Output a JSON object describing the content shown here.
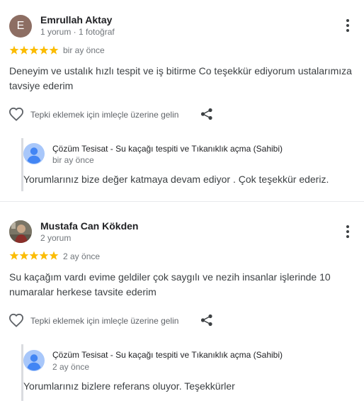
{
  "colors": {
    "star": "#fbbc04",
    "accent": "#4285f4",
    "avatar_bg": "#8d6e63"
  },
  "reviews": [
    {
      "avatar_letter": "E",
      "author": "Emrullah Aktay",
      "meta": "1 yorum · 1 fotoğraf",
      "rating": 5,
      "time": "bir ay önce",
      "text": "Deneyim ve ustalık hızlı tespit ve iş bitirme Co teşekkür ediyorum ustalarımıza tavsiye ederim",
      "like_hint": "Tepki eklemek için imleçle üzerine gelin",
      "reply": {
        "owner": "Çözüm Tesisat - Su kaçağı tespiti ve Tıkanıklık açma (Sahibi)",
        "time": "bir ay önce",
        "text": "Yorumlarınız bize değer katmaya devam ediyor . Çok teşekkür ederiz."
      }
    },
    {
      "author": "Mustafa Can Kökden",
      "meta": "2 yorum",
      "rating": 5,
      "time": "2 ay önce",
      "text": "Su kaçağım vardı evime geldiler çok saygılı ve nezih insanlar işlerinde 10 numaralar herkese tavsite ederim",
      "like_hint": "Tepki eklemek için imleçle üzerine gelin",
      "reply": {
        "owner": "Çözüm Tesisat - Su kaçağı tespiti ve Tıkanıklık açma (Sahibi)",
        "time": "2 ay önce",
        "text": "Yorumlarınız bizlere referans oluyor. Teşekkürler"
      }
    }
  ]
}
